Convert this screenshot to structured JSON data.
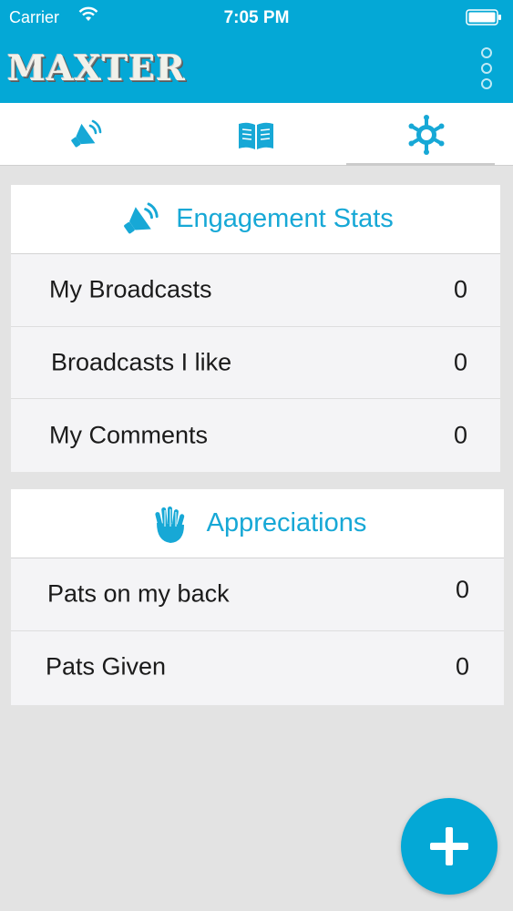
{
  "status_bar": {
    "carrier": "Carrier",
    "time": "7:05 PM"
  },
  "app": {
    "logo": "MAXTER",
    "accent_color": "#04a8d6",
    "title_color": "#17a8d6"
  },
  "tabs": [
    {
      "icon": "megaphone-icon",
      "active": false
    },
    {
      "icon": "open-book-icon",
      "active": false
    },
    {
      "icon": "gear-star-icon",
      "active": true
    }
  ],
  "engagement": {
    "title": "Engagement Stats",
    "icon": "megaphone-icon",
    "rows": [
      {
        "label": "My Broadcasts",
        "value": "0"
      },
      {
        "label": "Broadcasts I like",
        "value": "0"
      },
      {
        "label": "My Comments",
        "value": "0"
      }
    ]
  },
  "appreciations": {
    "title": "Appreciations",
    "icon": "clapping-hands-icon",
    "rows": [
      {
        "label": "Pats on my back",
        "value": "0"
      },
      {
        "label": "Pats Given",
        "value": "0"
      }
    ]
  },
  "fab": {
    "icon": "plus-icon"
  }
}
